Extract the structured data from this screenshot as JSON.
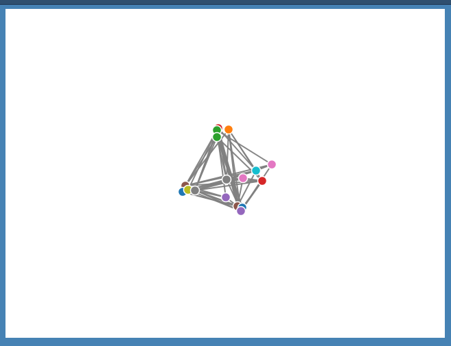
{
  "graph": {
    "nodes": [
      {
        "id": "n0",
        "color": "#d62728"
      },
      {
        "id": "n1",
        "color": "#ff7f0e"
      },
      {
        "id": "n2",
        "color": "#2ca02c"
      },
      {
        "id": "n3",
        "color": "#2ca02c"
      },
      {
        "id": "n4",
        "color": "#e377c2"
      },
      {
        "id": "n5",
        "color": "#17becf"
      },
      {
        "id": "n6",
        "color": "#d62728"
      },
      {
        "id": "n7",
        "color": "#e377c2"
      },
      {
        "id": "n8",
        "color": "#7f7f7f"
      },
      {
        "id": "n9",
        "color": "#8c564b"
      },
      {
        "id": "n10",
        "color": "#1f77b4"
      },
      {
        "id": "n11",
        "color": "#bcbd22"
      },
      {
        "id": "n12",
        "color": "#7f7f7f"
      },
      {
        "id": "n13",
        "color": "#9467bd"
      },
      {
        "id": "n14",
        "color": "#8c564b"
      },
      {
        "id": "n15",
        "color": "#1f77b4"
      },
      {
        "id": "n16",
        "color": "#9467bd"
      }
    ],
    "edges": [
      [
        "n0",
        "n9"
      ],
      [
        "n0",
        "n12"
      ],
      [
        "n0",
        "n14"
      ],
      [
        "n0",
        "n8"
      ],
      [
        "n0",
        "n5"
      ],
      [
        "n0",
        "n16"
      ],
      [
        "n1",
        "n9"
      ],
      [
        "n1",
        "n5"
      ],
      [
        "n1",
        "n6"
      ],
      [
        "n1",
        "n14"
      ],
      [
        "n1",
        "n8"
      ],
      [
        "n1",
        "n16"
      ],
      [
        "n2",
        "n12"
      ],
      [
        "n2",
        "n14"
      ],
      [
        "n2",
        "n4"
      ],
      [
        "n2",
        "n13"
      ],
      [
        "n2",
        "n15"
      ],
      [
        "n2",
        "n11"
      ],
      [
        "n3",
        "n9"
      ],
      [
        "n3",
        "n16"
      ],
      [
        "n3",
        "n8"
      ],
      [
        "n3",
        "n15"
      ],
      [
        "n3",
        "n6"
      ],
      [
        "n3",
        "n12"
      ],
      [
        "n9",
        "n4"
      ],
      [
        "n9",
        "n6"
      ],
      [
        "n9",
        "n5"
      ],
      [
        "n9",
        "n16"
      ],
      [
        "n9",
        "n13"
      ],
      [
        "n12",
        "n6"
      ],
      [
        "n12",
        "n7"
      ],
      [
        "n12",
        "n5"
      ],
      [
        "n12",
        "n14"
      ],
      [
        "n12",
        "n15"
      ],
      [
        "n11",
        "n8"
      ],
      [
        "n11",
        "n16"
      ],
      [
        "n11",
        "n7"
      ],
      [
        "n10",
        "n15"
      ],
      [
        "n10",
        "n14"
      ],
      [
        "n8",
        "n4"
      ],
      [
        "n8",
        "n5"
      ],
      [
        "n8",
        "n7"
      ],
      [
        "n8",
        "n6"
      ],
      [
        "n8",
        "n16"
      ],
      [
        "n7",
        "n14"
      ],
      [
        "n7",
        "n6"
      ],
      [
        "n4",
        "n16"
      ],
      [
        "n4",
        "n5"
      ],
      [
        "n5",
        "n14"
      ],
      [
        "n6",
        "n16"
      ],
      [
        "n6",
        "n15"
      ],
      [
        "n13",
        "n14"
      ],
      [
        "n13",
        "n12"
      ],
      [
        "n14",
        "n16"
      ]
    ]
  }
}
